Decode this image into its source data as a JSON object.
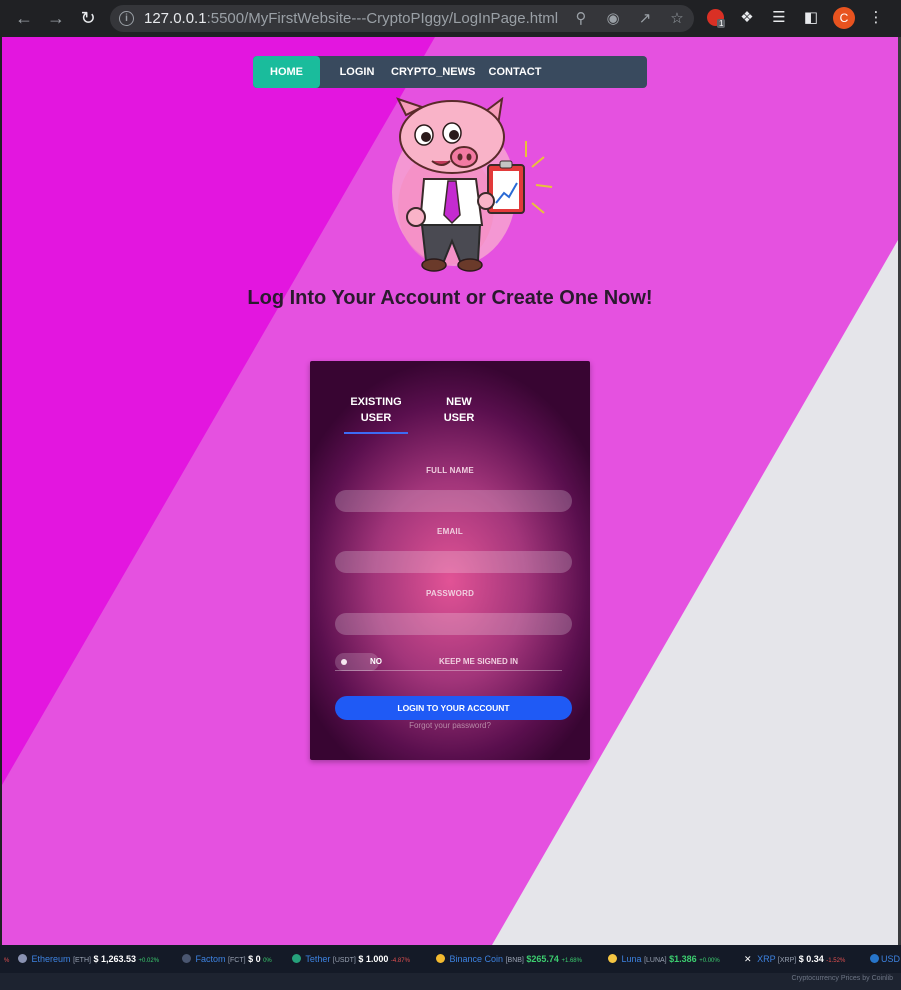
{
  "browser": {
    "url_host": "127.0.0.1",
    "url_rest": ":5500/MyFirstWebsite---CryptoPIggy/LogInPage.html",
    "profile_initial": "C",
    "extension_badge": "1"
  },
  "navbar": {
    "items": [
      {
        "label": "HOME"
      },
      {
        "label": "LOGIN"
      },
      {
        "label": "CRYPTO_NEWS"
      },
      {
        "label": "CONTACT"
      }
    ]
  },
  "headline": "Log Into Your Account or Create One Now!",
  "form": {
    "tabs": [
      {
        "line1": "EXISTING",
        "line2": "USER"
      },
      {
        "line1": "NEW",
        "line2": "USER"
      }
    ],
    "fields": [
      {
        "label": "FULL NAME"
      },
      {
        "label": "EMAIL"
      },
      {
        "label": "PASSWORD"
      }
    ],
    "toggle_state": "NO",
    "keep_signed_in": "KEEP ME SIGNED IN",
    "submit_label": "LOGIN TO YOUR ACCOUNT",
    "forgot_label": "Forgot your password?"
  },
  "ticker": {
    "items": [
      {
        "name": "Ethereum",
        "symbol": "[ETH]",
        "price": "$ 1,263.53",
        "change": "+0.02%",
        "dir": "up"
      },
      {
        "name": "Factom",
        "symbol": "[FCT]",
        "price": "$ 0",
        "change": "0%",
        "dir": "up"
      },
      {
        "name": "Tether",
        "symbol": "[USDT]",
        "price": "$ 1.000",
        "change": "-4.87%",
        "dir": "dn"
      },
      {
        "name": "Binance Coin",
        "symbol": "[BNB]",
        "price": "$265.74",
        "change": "+1.68%",
        "dir": "up"
      },
      {
        "name": "Luna",
        "symbol": "[LUNA]",
        "price": "$1.386",
        "change": "+0.00%",
        "dir": "up"
      },
      {
        "name": "XRP",
        "symbol": "[XRP]",
        "price": "$ 0.34",
        "change": "-1.52%",
        "dir": "dn"
      }
    ],
    "trailing": "USD",
    "credit": "Cryptocurrency Prices by Coinlib"
  },
  "colors": {
    "page_bg": "#e551e0",
    "left_band": "#e316df",
    "right_band": "#e5e5ea",
    "nav_bg": "#394a5e",
    "nav_active": "#1abc9c",
    "submit": "#1f5af5"
  }
}
